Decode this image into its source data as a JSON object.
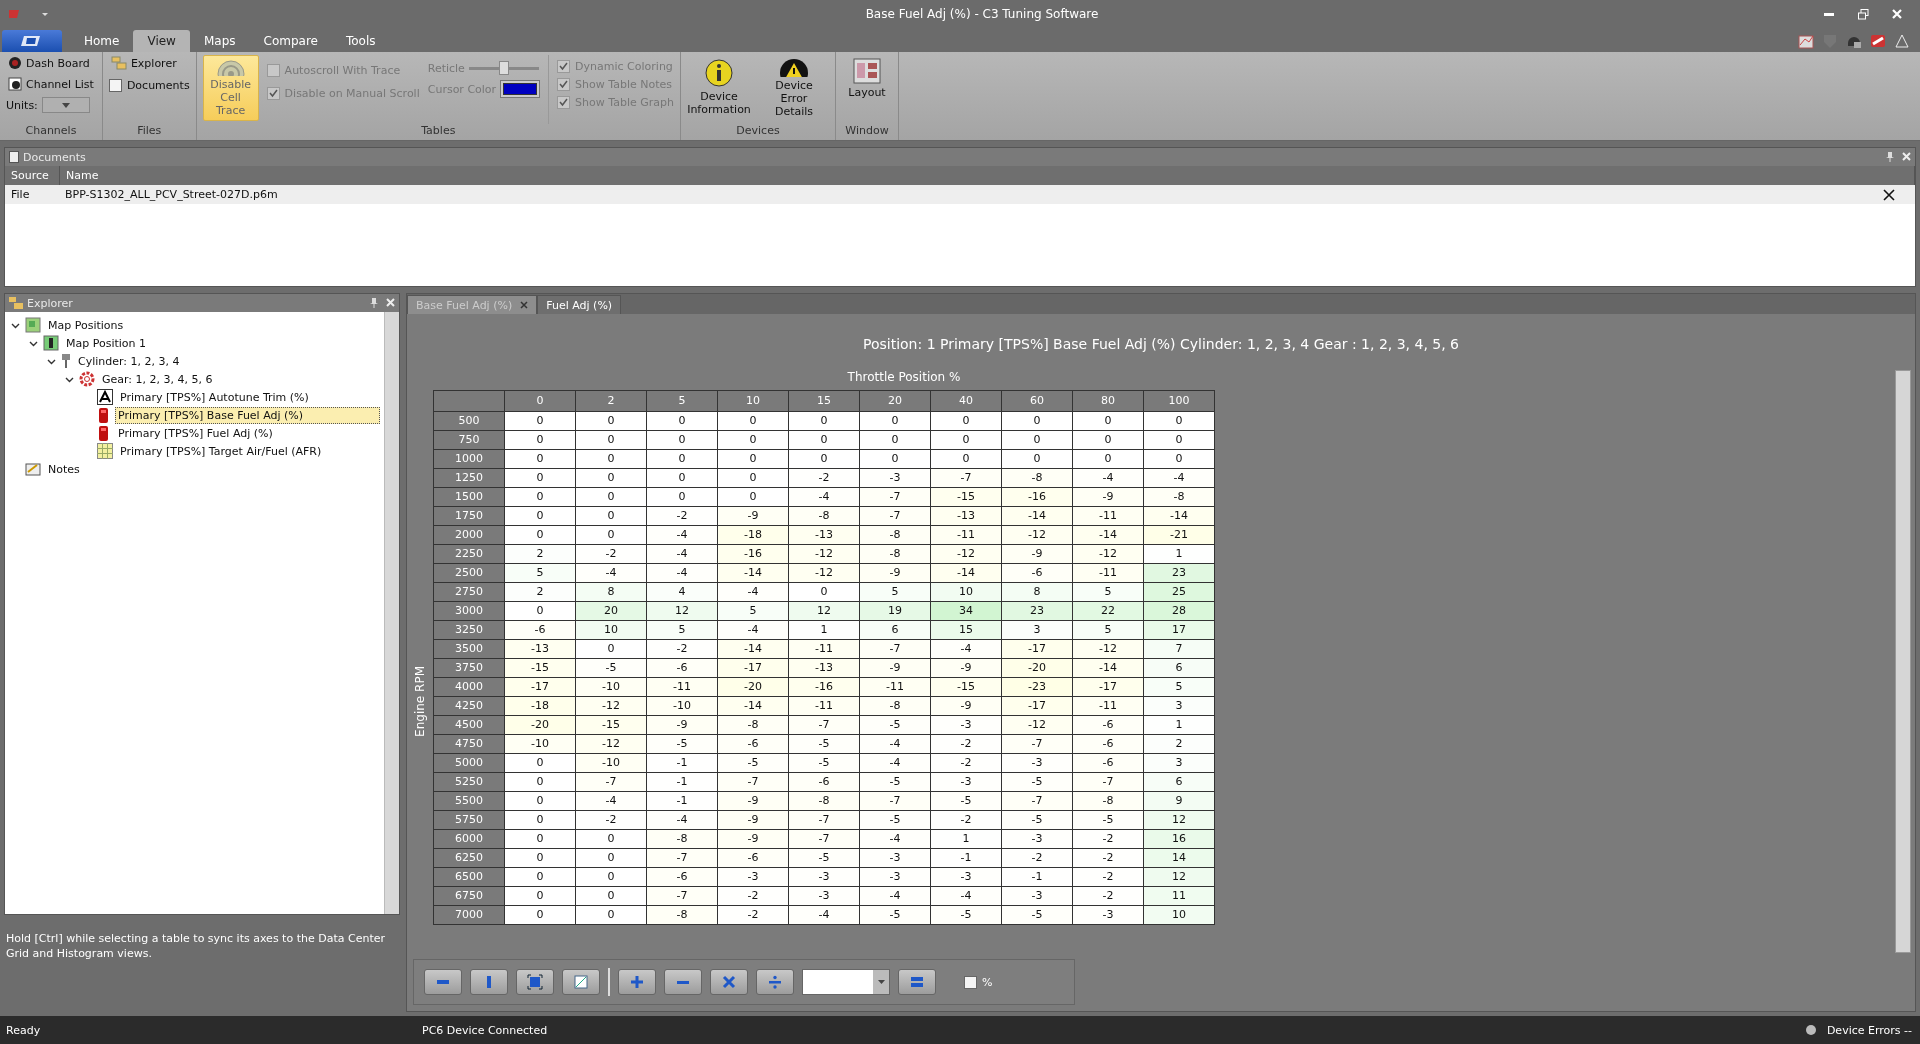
{
  "window": {
    "title": "Base Fuel Adj (%) - C3 Tuning Software"
  },
  "ribbon": {
    "tabs": [
      {
        "label": "Home",
        "selected": false
      },
      {
        "label": "View",
        "selected": true
      },
      {
        "label": "Maps",
        "selected": false
      },
      {
        "label": "Compare",
        "selected": false
      },
      {
        "label": "Tools",
        "selected": false
      }
    ],
    "channels": {
      "label": "Channels",
      "dash_board": "Dash Board",
      "channel_list": "Channel List",
      "units_label": "Units:"
    },
    "files": {
      "label": "Files",
      "explorer": "Explorer",
      "documents": {
        "label": "Documents",
        "checked": false
      }
    },
    "tables": {
      "label": "Tables",
      "disable_cell_trace": {
        "label": "Disable Cell Trace",
        "on": true
      },
      "options": [
        {
          "label": "Autoscroll With Trace",
          "checked": false,
          "disabled": true
        },
        {
          "label": "Disable on Manual Scroll",
          "checked": true,
          "disabled": true
        }
      ],
      "reticle": {
        "label": "Reticle",
        "level": 0.5
      },
      "cursor_color": {
        "label": "Cursor Color",
        "color": "#0000c0"
      },
      "display": [
        {
          "label": "Dynamic Coloring",
          "checked": true,
          "disabled": true
        },
        {
          "label": "Show Table Notes",
          "checked": true,
          "disabled": true
        },
        {
          "label": "Show Table Graph",
          "checked": true,
          "disabled": true
        }
      ]
    },
    "devices": {
      "label": "Devices",
      "device_information": "Device Information",
      "device_error_details": "Device Error Details"
    },
    "window_group": {
      "label": "Window",
      "layout": "Layout"
    }
  },
  "documents": {
    "title": "Documents",
    "columns": [
      "Source",
      "Name"
    ],
    "rows": [
      [
        "File",
        "BPP-S1302_ALL_PCV_Street-027D.p6m"
      ]
    ]
  },
  "explorer": {
    "title": "Explorer",
    "tree": [
      {
        "label": "Map Positions",
        "kind": "map",
        "expanded": true,
        "selected": false,
        "children": [
          {
            "label": "Map Position 1",
            "kind": "position",
            "expanded": true,
            "selected": false,
            "children": [
              {
                "label": "Cylinder: 1, 2, 3, 4",
                "kind": "cylinder",
                "expanded": true,
                "selected": false,
                "children": [
                  {
                    "label": "Gear: 1, 2, 3, 4, 5, 6",
                    "kind": "gear",
                    "expanded": true,
                    "selected": false,
                    "children": [
                      {
                        "label": "Primary  [TPS%] Autotune Trim (%)",
                        "kind": "autotune",
                        "selected": false
                      },
                      {
                        "label": "Primary  [TPS%] Base Fuel Adj (%)",
                        "kind": "fuel",
                        "selected": true
                      },
                      {
                        "label": "Primary  [TPS%] Fuel Adj (%)",
                        "kind": "fuel",
                        "selected": false
                      },
                      {
                        "label": "Primary  [TPS%] Target Air/Fuel (AFR)",
                        "kind": "grid",
                        "selected": false
                      }
                    ]
                  }
                ]
              }
            ]
          }
        ]
      },
      {
        "label": "Notes",
        "kind": "notes",
        "selected": false
      }
    ],
    "hint": "Hold [Ctrl] while selecting a table to sync its axes to the Data Center Grid and Histogram views."
  },
  "map": {
    "tabs": [
      {
        "label": "Base Fuel Adj (%)",
        "selected": true
      },
      {
        "label": "Fuel Adj (%)",
        "selected": false
      }
    ],
    "heading": "Position: 1  Primary  [TPS%] Base Fuel Adj (%)  Cylinder: 1, 2, 3, 4  Gear : 1, 2, 3, 4, 5, 6",
    "x_axis": "Throttle Position %",
    "y_axis": "Engine RPM",
    "columns": [
      "0",
      "2",
      "5",
      "10",
      "15",
      "20",
      "40",
      "60",
      "80",
      "100"
    ],
    "rows": [
      {
        "rpm": "500",
        "cells": [
          "0",
          "0",
          "0",
          "0",
          "0",
          "0",
          "0",
          "0",
          "0",
          "0"
        ]
      },
      {
        "rpm": "750",
        "cells": [
          "0",
          "0",
          "0",
          "0",
          "0",
          "0",
          "0",
          "0",
          "0",
          "0"
        ]
      },
      {
        "rpm": "1000",
        "cells": [
          "0",
          "0",
          "0",
          "0",
          "0",
          "0",
          "0",
          "0",
          "0",
          "0"
        ]
      },
      {
        "rpm": "1250",
        "cells": [
          "0",
          "0",
          "0",
          "0",
          "-2",
          "-3",
          "-7",
          "-8",
          "-4",
          "-4"
        ]
      },
      {
        "rpm": "1500",
        "cells": [
          "0",
          "0",
          "0",
          "0",
          "-4",
          "-7",
          "-15",
          "-16",
          "-9",
          "-8"
        ]
      },
      {
        "rpm": "1750",
        "cells": [
          "0",
          "0",
          "-2",
          "-9",
          "-8",
          "-7",
          "-13",
          "-14",
          "-11",
          "-14"
        ]
      },
      {
        "rpm": "2000",
        "cells": [
          "0",
          "0",
          "-4",
          "-18",
          "-13",
          "-8",
          "-11",
          "-12",
          "-14",
          "-21"
        ]
      },
      {
        "rpm": "2250",
        "cells": [
          "2",
          "-2",
          "-4",
          "-16",
          "-12",
          "-8",
          "-12",
          "-9",
          "-12",
          "1"
        ]
      },
      {
        "rpm": "2500",
        "cells": [
          "5",
          "-4",
          "-4",
          "-14",
          "-12",
          "-9",
          "-14",
          "-6",
          "-11",
          "23"
        ]
      },
      {
        "rpm": "2750",
        "cells": [
          "2",
          "8",
          "4",
          "-4",
          "0",
          "5",
          "10",
          "8",
          "5",
          "25"
        ]
      },
      {
        "rpm": "3000",
        "cells": [
          "0",
          "20",
          "12",
          "5",
          "12",
          "19",
          "34",
          "23",
          "22",
          "28"
        ]
      },
      {
        "rpm": "3250",
        "cells": [
          "-6",
          "10",
          "5",
          "-4",
          "1",
          "6",
          "15",
          "3",
          "5",
          "17"
        ]
      },
      {
        "rpm": "3500",
        "cells": [
          "-13",
          "0",
          "-2",
          "-14",
          "-11",
          "-7",
          "-4",
          "-17",
          "-12",
          "7"
        ]
      },
      {
        "rpm": "3750",
        "cells": [
          "-15",
          "-5",
          "-6",
          "-17",
          "-13",
          "-9",
          "-9",
          "-20",
          "-14",
          "6"
        ]
      },
      {
        "rpm": "4000",
        "cells": [
          "-17",
          "-10",
          "-11",
          "-20",
          "-16",
          "-11",
          "-15",
          "-23",
          "-17",
          "5"
        ]
      },
      {
        "rpm": "4250",
        "cells": [
          "-18",
          "-12",
          "-10",
          "-14",
          "-11",
          "-8",
          "-9",
          "-17",
          "-11",
          "3"
        ]
      },
      {
        "rpm": "4500",
        "cells": [
          "-20",
          "-15",
          "-9",
          "-8",
          "-7",
          "-5",
          "-3",
          "-12",
          "-6",
          "1"
        ]
      },
      {
        "rpm": "4750",
        "cells": [
          "-10",
          "-12",
          "-5",
          "-6",
          "-5",
          "-4",
          "-2",
          "-7",
          "-6",
          "2"
        ]
      },
      {
        "rpm": "5000",
        "cells": [
          "0",
          "-10",
          "-1",
          "-5",
          "-5",
          "-4",
          "-2",
          "-3",
          "-6",
          "3"
        ]
      },
      {
        "rpm": "5250",
        "cells": [
          "0",
          "-7",
          "-1",
          "-7",
          "-6",
          "-5",
          "-3",
          "-5",
          "-7",
          "6"
        ]
      },
      {
        "rpm": "5500",
        "cells": [
          "0",
          "-4",
          "-1",
          "-9",
          "-8",
          "-7",
          "-5",
          "-7",
          "-8",
          "9"
        ]
      },
      {
        "rpm": "5750",
        "cells": [
          "0",
          "-2",
          "-4",
          "-9",
          "-7",
          "-5",
          "-2",
          "-5",
          "-5",
          "12"
        ]
      },
      {
        "rpm": "6000",
        "cells": [
          "0",
          "0",
          "-8",
          "-9",
          "-7",
          "-4",
          "1",
          "-3",
          "-2",
          "16"
        ]
      },
      {
        "rpm": "6250",
        "cells": [
          "0",
          "0",
          "-7",
          "-6",
          "-5",
          "-3",
          "-1",
          "-2",
          "-2",
          "14"
        ]
      },
      {
        "rpm": "6500",
        "cells": [
          "0",
          "0",
          "-6",
          "-3",
          "-3",
          "-3",
          "-3",
          "-1",
          "-2",
          "12"
        ]
      },
      {
        "rpm": "6750",
        "cells": [
          "0",
          "0",
          "-7",
          "-2",
          "-3",
          "-4",
          "-4",
          "-3",
          "-2",
          "11"
        ]
      },
      {
        "rpm": "7000",
        "cells": [
          "0",
          "0",
          "-8",
          "-2",
          "-4",
          "-5",
          "-5",
          "-5",
          "-3",
          "10"
        ]
      }
    ],
    "toolbar": {
      "percent": {
        "label": "%",
        "checked": false
      }
    }
  },
  "status_bar": {
    "left": "Ready",
    "middle": "PC6 Device Connected",
    "right": "Device Errors --"
  }
}
